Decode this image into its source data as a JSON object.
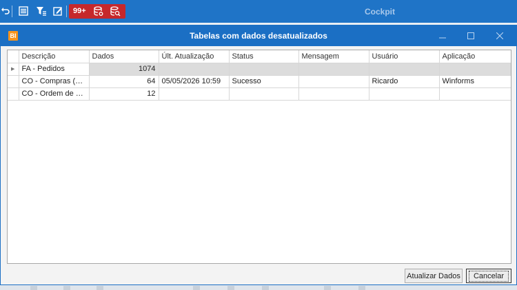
{
  "toolbar": {
    "badge_count": "99+",
    "app_title": "Cockpit",
    "icons": [
      "undo-icon",
      "list-icon",
      "filter-icon",
      "edit-icon",
      "database-settings-icon",
      "database-search-icon"
    ]
  },
  "dialog": {
    "logo_text": "BI",
    "title": "Tabelas com dados desatualizados",
    "columns": [
      "Descrição",
      "Dados",
      "Últ. Atualização",
      "Status",
      "Mensagem",
      "Usuário",
      "Aplicação"
    ],
    "rows": [
      {
        "descricao": "FA - Pedidos",
        "dados": "1074",
        "ultima_atualizacao": "",
        "status": "",
        "mensagem": "",
        "usuario": "",
        "aplicacao": ""
      },
      {
        "descricao": "CO - Compras (Notas)",
        "dados": "64",
        "ultima_atualizacao": "05/05/2026 10:59",
        "status": "Sucesso",
        "mensagem": "",
        "usuario": "Ricardo",
        "aplicacao": "Winforms"
      },
      {
        "descricao": "CO - Ordem de Com...",
        "dados": "12",
        "ultima_atualizacao": "",
        "status": "",
        "mensagem": "",
        "usuario": "",
        "aplicacao": ""
      }
    ],
    "buttons": {
      "update": "Atualizar Dados",
      "cancel": "Cancelar"
    }
  },
  "colors": {
    "toolbar_bg": "#1f74c7",
    "dialog_title_bg": "#1b6fc4",
    "badge_bg": "#c6282b",
    "logo_bg": "#f7941d",
    "selected_row_bg": "#dcdcdc"
  }
}
